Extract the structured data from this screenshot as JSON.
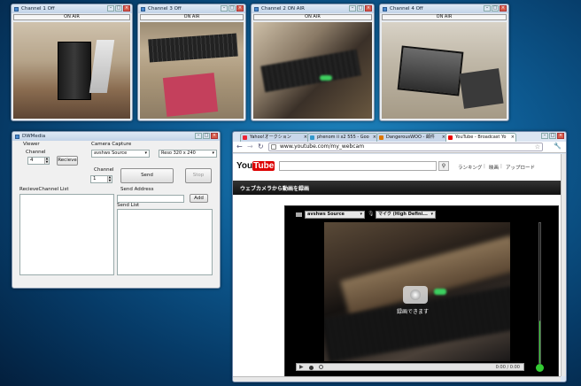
{
  "channels": [
    {
      "title": "Channel 1 Off",
      "onair": "ON AIR"
    },
    {
      "title": "Channel 3 Off",
      "onair": "ON AIR"
    },
    {
      "title": "Channel 2 ON AIR",
      "onair": "ON AIR"
    },
    {
      "title": "Channel 4 Off",
      "onair": "ON AIR"
    }
  ],
  "dwmedia": {
    "title": "DWMedia",
    "viewer_label": "Viewer",
    "channel_label": "Channel",
    "channel_value": "4",
    "recieve_button": "Recieve",
    "camera_capture_label": "Camera Capture",
    "camera_source": "avshws Source",
    "resolution": "Reso 320 x 240",
    "send_channel_label": "Channel",
    "send_channel_value": "1",
    "send_button": "Send",
    "stop_button": "Stop",
    "recieve_list_label": "RecieveChannel List",
    "send_address_label": "Send Address",
    "add_button": "Add",
    "send_list_label": "Send List"
  },
  "browser": {
    "tabs": [
      {
        "label": "Yahoo!オークション",
        "fav": "#e23"
      },
      {
        "label": "phenom ii x2 555 - Goo",
        "fav": "#39c"
      },
      {
        "label": "DangerousWOO - 邮件",
        "fav": "#d70"
      },
      {
        "label": "YouTube - Broadcast Yo",
        "fav": "#e00"
      }
    ],
    "address": "www.youtube.com/my_webcam",
    "logo_you": "You",
    "logo_tube": "Tube",
    "nav": [
      "ランキング",
      "映画",
      "アップロード"
    ],
    "nav_sep": "|",
    "heading": "ウェブカメラから動画を録画",
    "source_select": "avshws Source",
    "mic_select": "マイク (High Defini...",
    "record_label": "録画できます",
    "time": "0:00 / 0:00",
    "icons": {
      "back": "back-arrow-icon",
      "forward": "forward-arrow-icon",
      "reload": "reload-icon",
      "star": "star-icon",
      "wrench": "wrench-icon",
      "search": "search-icon",
      "camera": "camera-icon",
      "mic": "microphone-icon",
      "play": "play-icon",
      "record": "record-dot-icon",
      "volume": "volume-icon"
    }
  }
}
